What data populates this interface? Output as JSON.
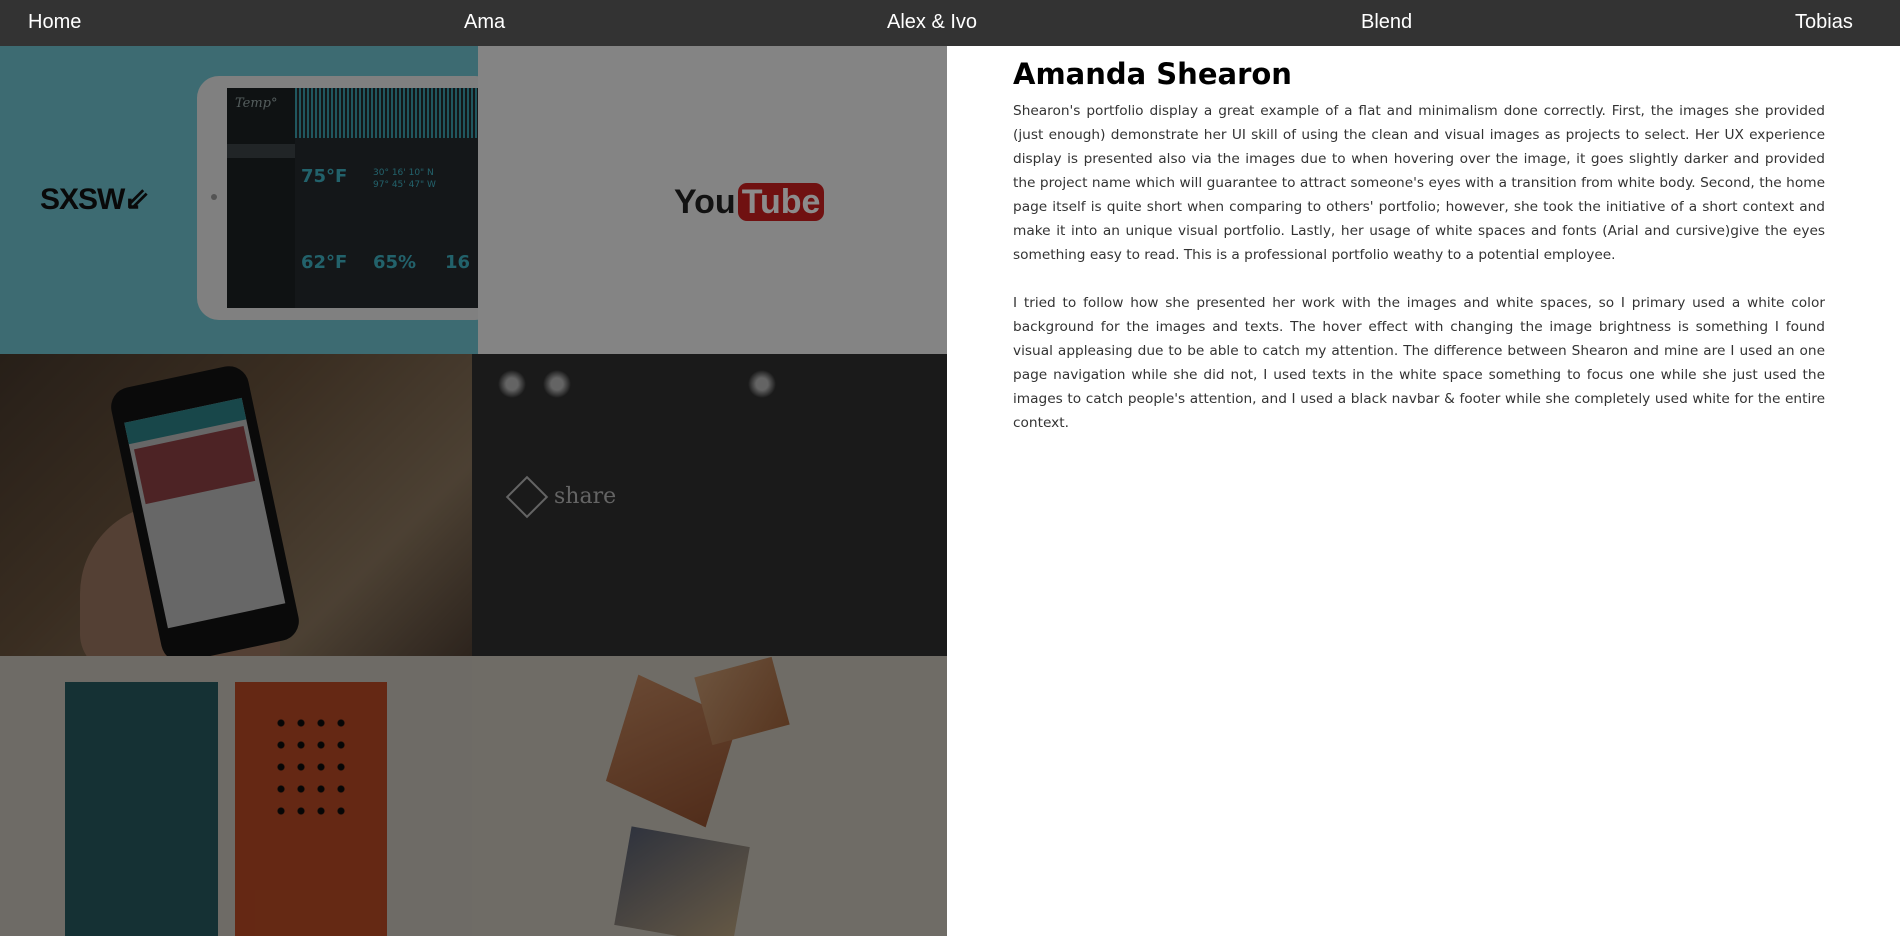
{
  "nav": {
    "items": [
      "Home",
      "Ama",
      "Alex & Ivo",
      "Blend",
      "Tobias"
    ]
  },
  "gallery": {
    "tiles": {
      "sxsw_logo": "SXSW",
      "tablet_app": "Temp°",
      "tablet_temp1": "75°F",
      "tablet_temp2": "62°F",
      "tablet_pct": "65%",
      "tablet_val": "16",
      "tablet_coords1": "30° 16' 10\" N",
      "tablet_coords2": "97° 45' 47\" W",
      "youtube_you": "You",
      "youtube_tube": "Tube",
      "share_logo": "share"
    }
  },
  "content": {
    "title": "Amanda Shearon",
    "paragraph1": "Shearon's portfolio display a great example of a flat and minimalism done correctly. First, the images she provided (just enough) demonstrate her UI skill of using the clean and visual images as projects to select. Her UX experience display is presented also via the images due to when hovering over the image, it goes slightly darker and provided the project name which will guarantee to attract someone's eyes with a transition from white body. Second, the home page itself is quite short when comparing to others' portfolio; however, she took the initiative of a short context and make it into an unique visual portfolio. Lastly, her usage of white spaces and fonts (Arial and cursive)give the eyes something easy to read. This is a professional portfolio weathy to a potential employee.",
    "paragraph2": "I tried to follow how she presented her work with the images and white spaces, so I primary used a white color background for the images and texts. The hover effect with changing the image brightness is something I found visual appleasing due to be able to catch my attention. The difference between Shearon and mine are I used an one page navigation while she did not, I used texts in the white space something to focus one while she just used the images to catch people's attention, and I used a black navbar & footer while she completely used white for the entire context."
  },
  "colors": {
    "navbar": "#333333",
    "nav_text": "#ffffff",
    "page_bg": "#ffffff",
    "title_text": "#000000",
    "body_text": "#333333",
    "gallery_overlay": "#000000"
  }
}
